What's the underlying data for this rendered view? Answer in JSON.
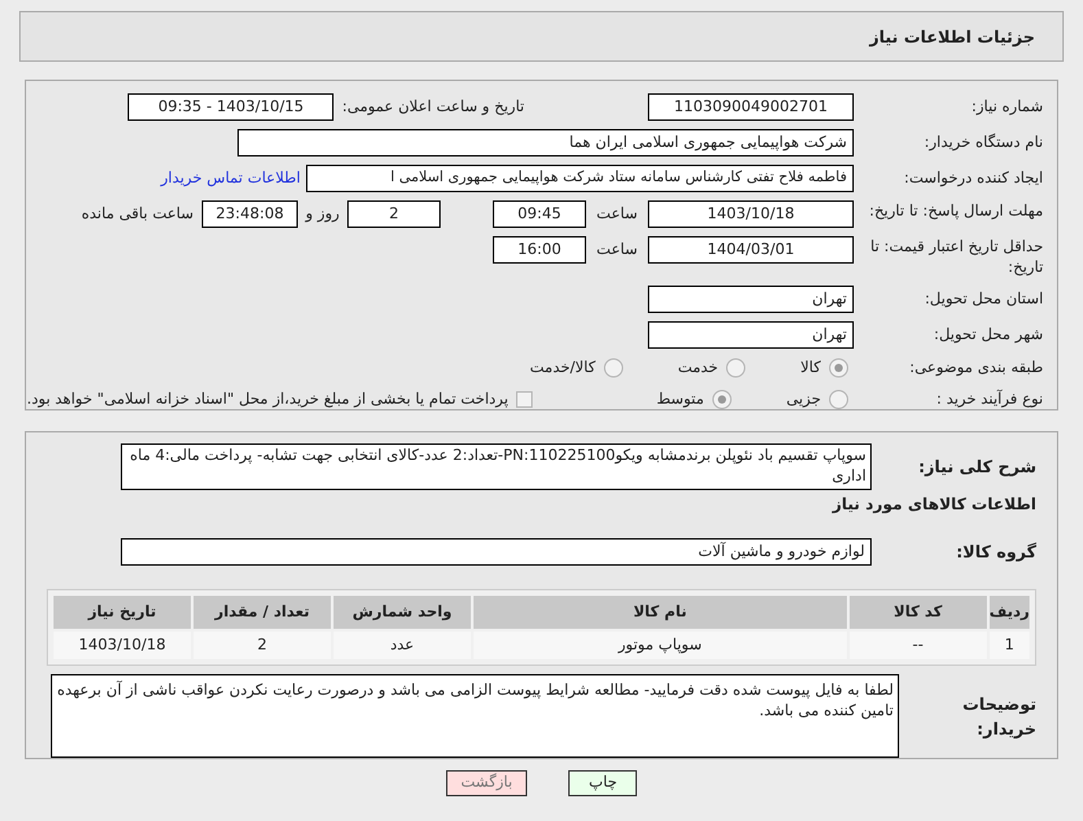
{
  "header": {
    "title": "جزئیات اطلاعات نیاز"
  },
  "need_number": {
    "label": "شماره نیاز:",
    "value": "1103090049002701"
  },
  "announce": {
    "label": "تاریخ و ساعت اعلان عمومی:",
    "value": "1403/10/15 - 09:35"
  },
  "buyer": {
    "label": "نام دستگاه خریدار:",
    "value": "شرکت هواپیمایی جمهوری اسلامی ایران هما"
  },
  "requester": {
    "label": "ایجاد کننده درخواست:",
    "value": "فاطمه فلاح تفتی کارشناس سامانه ستاد شرکت هواپیمایی جمهوری اسلامی ا",
    "link": "اطلاعات تماس خریدار"
  },
  "deadline": {
    "label": "مهلت ارسال پاسخ: تا تاریخ:",
    "date": "1403/10/18",
    "time_label": "ساعت",
    "time": "09:45",
    "days": "2",
    "days_label": "روز و",
    "remaining": "23:48:08",
    "remaining_label": "ساعت باقی مانده"
  },
  "validity": {
    "label": "حداقل تاریخ اعتبار قیمت: تا تاریخ:",
    "date": "1404/03/01",
    "time_label": "ساعت",
    "time": "16:00"
  },
  "province": {
    "label": "استان محل تحویل:",
    "value": "تهران"
  },
  "city": {
    "label": "شهر محل تحویل:",
    "value": "تهران"
  },
  "category": {
    "label": "طبقه بندی موضوعی:",
    "options": [
      {
        "label": "کالا",
        "selected": true
      },
      {
        "label": "خدمت",
        "selected": false
      },
      {
        "label": "کالا/خدمت",
        "selected": false
      }
    ]
  },
  "process": {
    "label": "نوع فرآیند خرید :",
    "options": [
      {
        "label": "جزیی",
        "selected": false
      },
      {
        "label": "متوسط",
        "selected": true
      }
    ],
    "treasury": {
      "label": "پرداخت تمام یا بخشی از مبلغ خرید،از محل \"اسناد خزانه اسلامی\" خواهد بود.",
      "checked": false
    }
  },
  "description": {
    "label": "شرح کلی نیاز:",
    "value": "سوپاپ تقسیم باد نئوپلن برندمشابه ویکوPN:110225100-تعداد:2 عدد-کالای انتخابی جهت تشابه- پرداخت مالی:4 ماه اداری"
  },
  "goods_heading": "اطلاعات کالاهای مورد نیاز",
  "goods_group": {
    "label": "گروه کالا:",
    "value": "لوازم خودرو و ماشین آلات"
  },
  "table": {
    "columns": [
      "ردیف",
      "کد کالا",
      "نام کالا",
      "واحد شمارش",
      "تعداد / مقدار",
      "تاریخ نیاز"
    ],
    "rows": [
      [
        "1",
        "--",
        "سوپاپ موتور",
        "عدد",
        "2",
        "1403/10/18"
      ]
    ]
  },
  "buyer_notes": {
    "label": "توضیحات خریدار:",
    "value": "لطفا به فایل پیوست شده دقت فرمایید- مطالعه شرایط پیوست الزامی می باشد و درصورت رعایت نکردن عواقب ناشی از آن برعهده تامین کننده می باشد."
  },
  "buttons": [
    {
      "label": "چاپ",
      "kind": "print"
    },
    {
      "label": "بازگشت",
      "kind": "back"
    }
  ]
}
